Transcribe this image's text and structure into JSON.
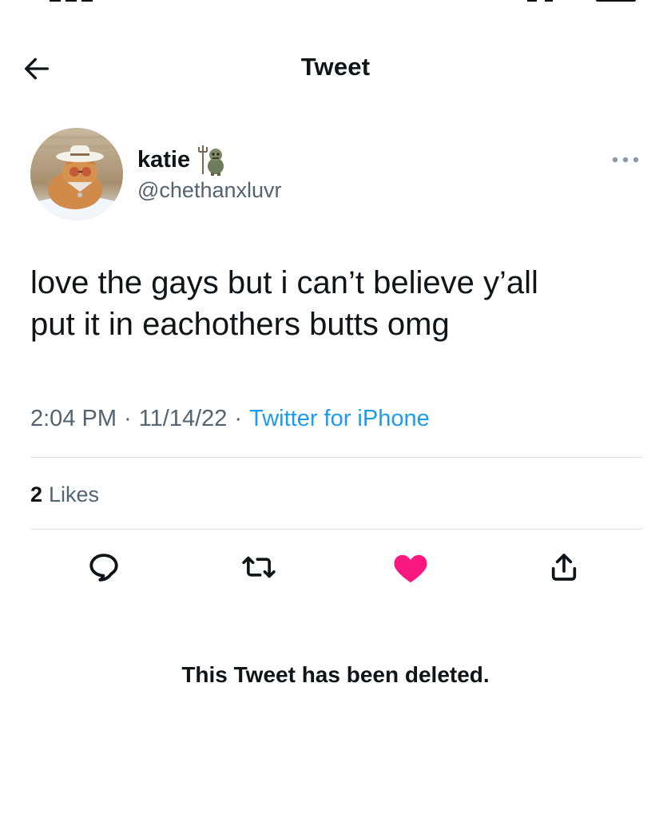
{
  "header": {
    "title": "Tweet"
  },
  "author": {
    "display_name": "katie",
    "handle": "@chethanxluvr"
  },
  "tweet": {
    "text": "love the gays but i can’t believe y’all\nput it in eachothers butts omg",
    "time": "2:04 PM",
    "date": "11/14/22",
    "separator": "·",
    "source": "Twitter for iPhone"
  },
  "stats": {
    "likes_count": "2",
    "likes_label": "Likes"
  },
  "actions": {
    "liked": true,
    "like_color": "#f91880"
  },
  "notice": {
    "deleted_text": "This Tweet has been deleted."
  },
  "colors": {
    "secondary_text": "#536471",
    "link": "#1d9bf0",
    "divider": "#dfe3e6"
  },
  "icons": {
    "back": "arrow-left-icon",
    "more": "more-horizontal-icon",
    "reply": "reply-icon",
    "retweet": "retweet-icon",
    "like": "heart-filled-icon",
    "share": "share-icon"
  }
}
